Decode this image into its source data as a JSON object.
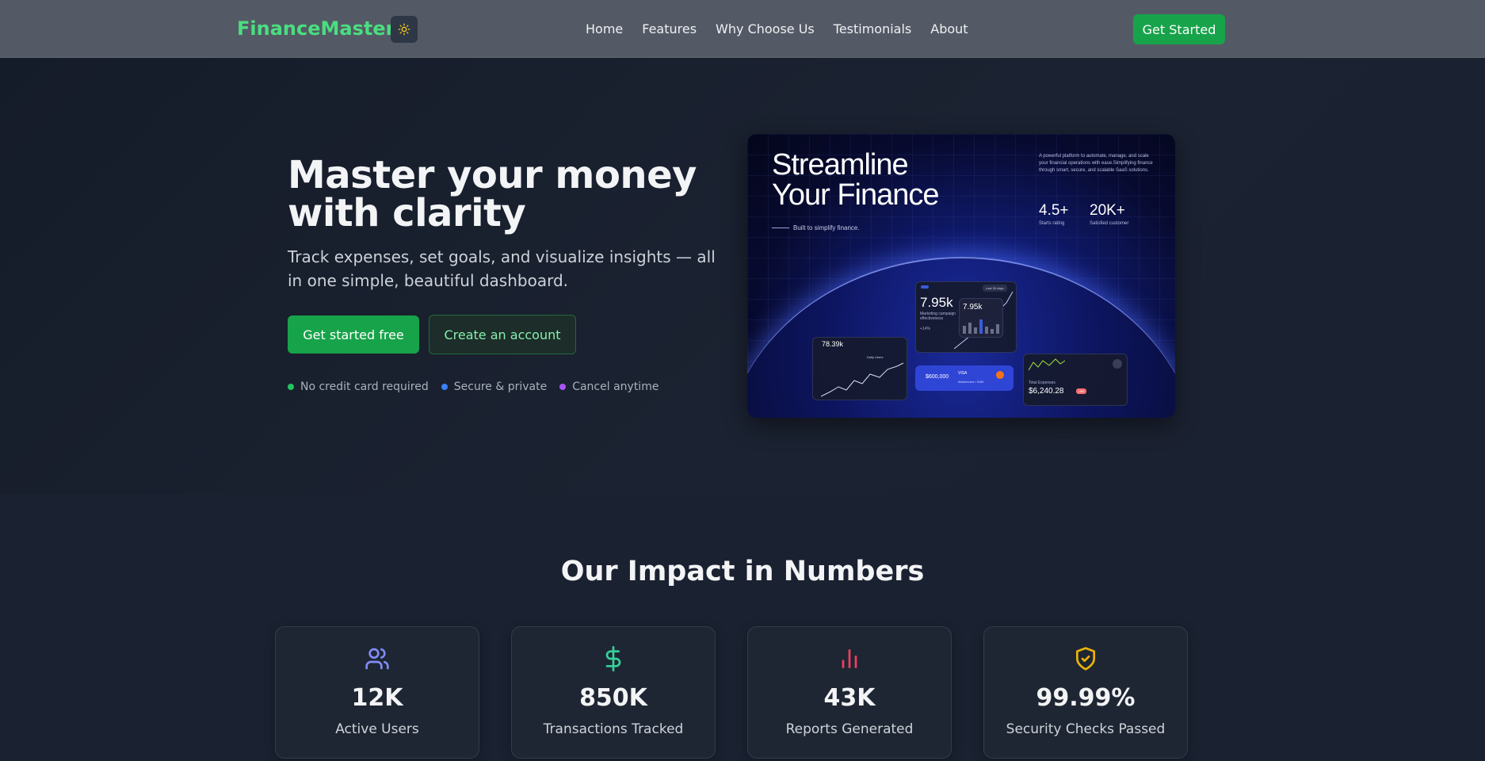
{
  "nav": {
    "brand": "FinanceMaster",
    "links": [
      "Home",
      "Features",
      "Why Choose Us",
      "Testimonials",
      "About"
    ],
    "cta": "Get Started",
    "theme_icon": "sun-icon"
  },
  "hero": {
    "title_line1": "Master your money",
    "title_line2": "with clarity",
    "subtitle": "Track expenses, set goals, and visualize insights — all in one simple, beautiful dashboard.",
    "primary_button": "Get started free",
    "secondary_button": "Create an account",
    "badges": [
      {
        "label": "No credit card required",
        "color": "#22c55e"
      },
      {
        "label": "Secure & private",
        "color": "#3b82f6"
      },
      {
        "label": "Cancel anytime",
        "color": "#a855f7"
      }
    ],
    "image": {
      "title_line1": "Streamline",
      "title_line2": "Your Finance",
      "tagline": "Built to simplify finance.",
      "description": "A powerful platform to automate, manage, and scale your financial operations with ease.Simplifying finance through smart, secure, and scalable SaaS solutions.",
      "stat1_value": "4.5+",
      "stat1_label": "Starts rating",
      "stat2_value": "20K+",
      "stat2_label": "Satisfied customer",
      "card_main_value": "7.95k",
      "card_main_label": "Marketing campaign effectiveness",
      "card_main_delta": "+14%",
      "card_small_value": "7.95k",
      "card_left_value": "78.39k",
      "card_left_label": "Daily Users",
      "card_visa_amount": "$600,000",
      "card_visa_brand": "VISA",
      "card_visa_sub": "Mastercard • 9180",
      "card_expense_label": "Total Expenses",
      "card_expense_value": "$6,240.28",
      "card_expense_badge": "-9%",
      "filter_label": "Last 30 days"
    }
  },
  "stats": {
    "title": "Our Impact in Numbers",
    "items": [
      {
        "value": "12K",
        "label": "Active Users",
        "icon": "users-icon",
        "color": "#818cf8"
      },
      {
        "value": "850K",
        "label": "Transactions Tracked",
        "icon": "dollar-icon",
        "color": "#34d399"
      },
      {
        "value": "43K",
        "label": "Reports Generated",
        "icon": "bar-chart-icon",
        "color": "#f43f5e"
      },
      {
        "value": "99.99%",
        "label": "Security Checks Passed",
        "icon": "shield-check-icon",
        "color": "#eab308"
      }
    ]
  }
}
